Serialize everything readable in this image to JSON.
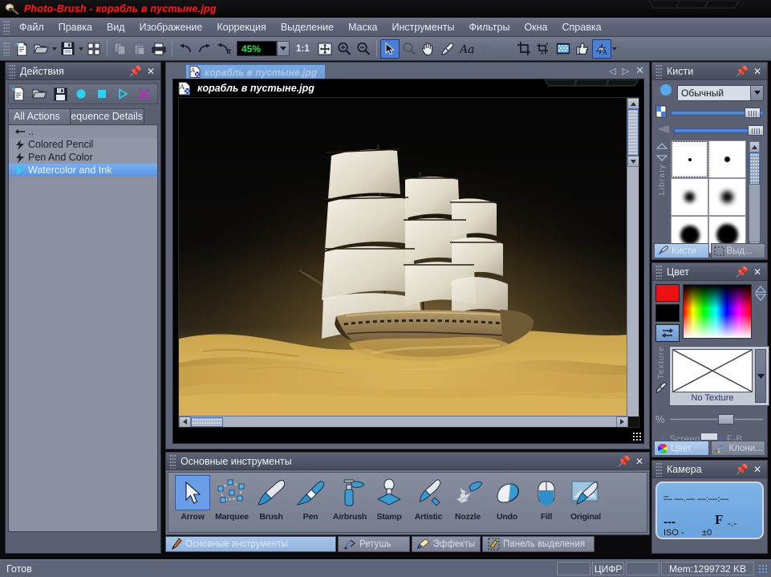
{
  "window": {
    "app_title": "Photo-Brush - корабль в пустыне.jpg",
    "app_icon": "paintbrush-icon",
    "accent_title_color": "#ee1c24"
  },
  "menubar": {
    "items": [
      {
        "label": "Файл",
        "mnemonic": "Ф"
      },
      {
        "label": "Правка",
        "mnemonic": "П"
      },
      {
        "label": "Вид",
        "mnemonic": "В"
      },
      {
        "label": "Изображение",
        "mnemonic": "И"
      },
      {
        "label": "Коррекция",
        "mnemonic": "К"
      },
      {
        "label": "Выделение",
        "mnemonic": "е"
      },
      {
        "label": "Маска",
        "mnemonic": "М"
      },
      {
        "label": "Инструменты",
        "mnemonic": "н"
      },
      {
        "label": "Фильтры",
        "mnemonic": ""
      },
      {
        "label": "Окна",
        "mnemonic": "О"
      },
      {
        "label": "Справка",
        "mnemonic": "С"
      }
    ]
  },
  "toolbar": {
    "zoom_value": "45%",
    "ratio_label": "1:1",
    "buttons": [
      {
        "name": "new-document-icon",
        "enabled": true
      },
      {
        "name": "open-document-icon",
        "enabled": true
      },
      {
        "name": "save-document-icon",
        "enabled": true
      },
      {
        "name": "thumbnails-icon",
        "enabled": true
      },
      {
        "name": "copy-icon",
        "enabled": false
      },
      {
        "name": "paste-icon",
        "enabled": false
      },
      {
        "name": "print-icon",
        "enabled": true
      },
      {
        "name": "undo-icon",
        "enabled": true
      },
      {
        "name": "redo-icon",
        "enabled": true
      },
      {
        "name": "undo-history-icon",
        "enabled": true
      },
      {
        "name": "fit-to-window-icon",
        "enabled": true
      },
      {
        "name": "zoom-in-icon",
        "enabled": true
      },
      {
        "name": "zoom-out-icon",
        "enabled": true
      },
      {
        "name": "arrow-tool-icon",
        "enabled": true,
        "selected": true
      },
      {
        "name": "magnifier-tool-icon",
        "enabled": false
      },
      {
        "name": "hand-tool-icon",
        "enabled": true
      },
      {
        "name": "eyedropper-tool-icon",
        "enabled": true
      },
      {
        "name": "text-tool-icon",
        "enabled": true
      },
      {
        "name": "lasso-tool-icon",
        "enabled": false
      },
      {
        "name": "selection-tool-icon",
        "enabled": false
      },
      {
        "name": "crop-tool-icon",
        "enabled": true
      },
      {
        "name": "perspective-crop-icon",
        "enabled": true
      },
      {
        "name": "transparency-icon",
        "enabled": true
      },
      {
        "name": "thumb-up-icon",
        "enabled": true
      },
      {
        "name": "auto-fix-icon",
        "enabled": true,
        "selected": true
      }
    ]
  },
  "actions_panel": {
    "title": "Действия",
    "toolbar": [
      {
        "name": "new-action-icon"
      },
      {
        "name": "open-action-icon"
      },
      {
        "name": "save-action-icon"
      },
      {
        "name": "record-icon"
      },
      {
        "name": "stop-icon"
      },
      {
        "name": "play-icon"
      },
      {
        "name": "delete-icon"
      }
    ],
    "tabs": [
      {
        "label": "All Actions",
        "active": true
      },
      {
        "label": "Sequence Details",
        "active": false
      }
    ],
    "rows": [
      {
        "label": "..",
        "icon": "back-arrow-icon",
        "selected": false
      },
      {
        "label": "Colored Pencil",
        "icon": "action-icon",
        "selected": false
      },
      {
        "label": "Pen And Color",
        "icon": "action-icon",
        "selected": false
      },
      {
        "label": "Watercolor and Ink",
        "icon": "play-icon",
        "selected": true
      }
    ]
  },
  "document": {
    "tab_label": "корабль в пустыне.jpg",
    "window_title": "корабль в пустыне.jpg",
    "nav": [
      "prev-document-icon",
      "next-document-icon",
      "close-document-icon"
    ],
    "image_alt": "Парусный корабль в пустыне"
  },
  "tools_panel": {
    "title": "Основные инструменты",
    "tools": [
      {
        "label": "Arrow",
        "icon": "arrow-tool-icon",
        "selected": true
      },
      {
        "label": "Marquee",
        "icon": "marquee-tool-icon",
        "selected": false
      },
      {
        "label": "Brush",
        "icon": "brush-tool-icon",
        "selected": false
      },
      {
        "label": "Pen",
        "icon": "pen-tool-icon",
        "selected": false
      },
      {
        "label": "Airbrush",
        "icon": "airbrush-tool-icon",
        "selected": false
      },
      {
        "label": "Stamp",
        "icon": "stamp-tool-icon",
        "selected": false
      },
      {
        "label": "Artistic",
        "icon": "artistic-tool-icon",
        "selected": false
      },
      {
        "label": "Nozzle",
        "icon": "nozzle-tool-icon",
        "selected": false
      },
      {
        "label": "Undo",
        "icon": "undo-tool-icon",
        "selected": false
      },
      {
        "label": "Fill",
        "icon": "fill-tool-icon",
        "selected": false
      },
      {
        "label": "Original",
        "icon": "original-tool-icon",
        "selected": false
      }
    ]
  },
  "bottom_tabs": [
    {
      "label": "Основные инструменты",
      "icon": "pen-icon",
      "active": true
    },
    {
      "label": "Ретушь",
      "icon": "retouch-icon",
      "active": false
    },
    {
      "label": "Эффекты",
      "icon": "effects-icon",
      "active": false
    },
    {
      "label": "Панель выделения",
      "icon": "selection-icon",
      "active": false
    }
  ],
  "brushes_panel": {
    "title": "Кисти",
    "mode_value": "Обычный",
    "sliders": [
      {
        "name": "opacity-slider",
        "icon": "opacity-icon",
        "value": 92
      },
      {
        "name": "softness-slider",
        "icon": "softness-icon",
        "value": 92
      }
    ],
    "library_label": "Library",
    "brush_cells": [
      {
        "size": 4,
        "blur": 0,
        "selected": true
      },
      {
        "size": 7,
        "blur": 1,
        "selected": false
      },
      {
        "size": 13,
        "blur": 4,
        "selected": false
      },
      {
        "size": 15,
        "blur": 5,
        "selected": false
      },
      {
        "size": 24,
        "blur": 3,
        "selected": false
      },
      {
        "size": 27,
        "blur": 4,
        "selected": false
      }
    ],
    "tabs": [
      {
        "label": "Кисти",
        "icon": "brush-icon",
        "active": true
      },
      {
        "label": "Выд...",
        "icon": "selection-icon",
        "active": false
      }
    ]
  },
  "color_panel": {
    "title": "Цвет",
    "foreground": "#ee1111",
    "background": "#000000",
    "swap_icon": "swap-colors-icon",
    "texture_label": "Texture",
    "no_texture_label": "No Texture",
    "percent_label": "%",
    "percent_value": 62,
    "modes": [
      {
        "label": "Screen",
        "checked": false
      },
      {
        "label": "F-B",
        "checked": false
      }
    ],
    "tabs": [
      {
        "label": "Цвет",
        "icon": "color-wheel-icon",
        "active": true
      },
      {
        "label": "Клони...",
        "icon": "clone-icon",
        "active": false
      }
    ]
  },
  "camera_panel": {
    "title": "Камера",
    "line1": "_",
    "line2": "— —.— —:—:—",
    "shutter": "---",
    "aperture_label": "F",
    "aperture_value": "-.-",
    "iso_label": "ISO -",
    "exposure_value": "±0"
  },
  "statusbar": {
    "status_text": "Готов",
    "digit_field": "ЦИФР",
    "memory": "Mem:1299732 KB"
  }
}
